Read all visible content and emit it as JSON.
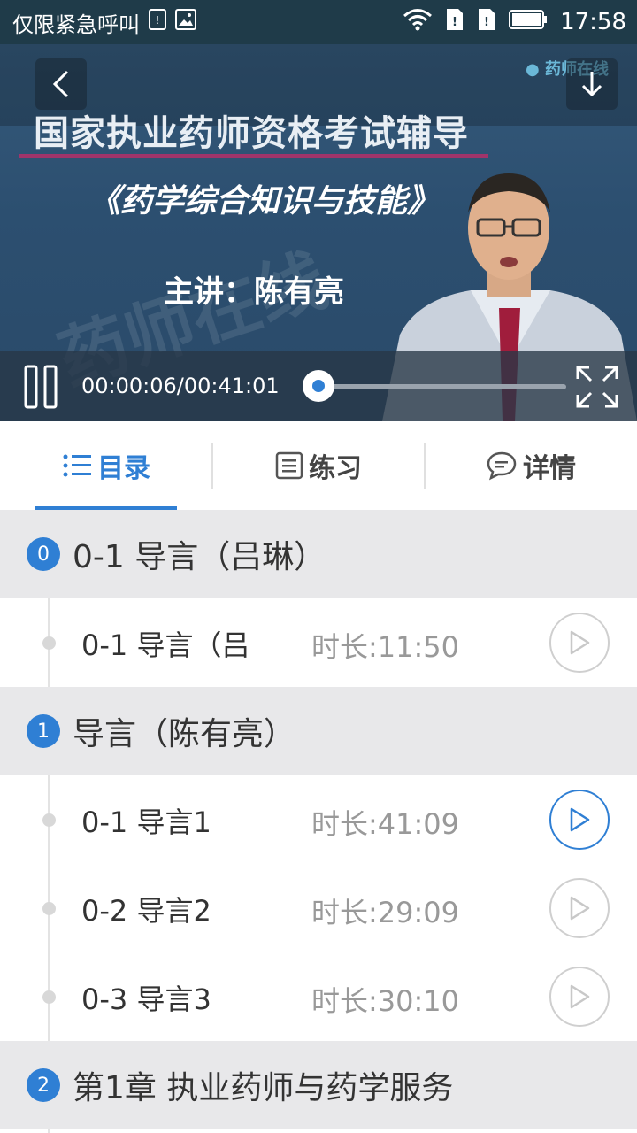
{
  "status_bar": {
    "carrier_text": "仅限紧急呼叫",
    "time": "17:58",
    "icons": [
      "sim-icon",
      "image-icon",
      "wifi-icon",
      "sim1-icon",
      "sim2-icon",
      "battery-icon"
    ]
  },
  "video": {
    "slide_title": "国家执业药师资格考试辅导",
    "slide_subtitle": "《药学综合知识与技能》",
    "slide_speaker": "主讲：陈有亮",
    "watermark": "药师在线",
    "logo_text": "药师在线",
    "time_display": "00:00:06/00:41:01",
    "progress": 0.0024,
    "accent_color": "#2f7fd4"
  },
  "tabs": [
    {
      "label": "目录",
      "icon": "list-icon",
      "active": true
    },
    {
      "label": "练习",
      "icon": "document-icon",
      "active": false
    },
    {
      "label": "详情",
      "icon": "chat-bubble-icon",
      "active": false
    }
  ],
  "chapters": [
    {
      "number": "0",
      "title": "0-1 导言（吕琳）",
      "lessons": [
        {
          "title": "0-1 导言（吕",
          "duration": "时长:11:50",
          "active": false
        }
      ]
    },
    {
      "number": "1",
      "title": "导言（陈有亮）",
      "lessons": [
        {
          "title": "0-1 导言1",
          "duration": "时长:41:09",
          "active": true
        },
        {
          "title": "0-2 导言2",
          "duration": "时长:29:09",
          "active": false
        },
        {
          "title": "0-3 导言3",
          "duration": "时长:30:10",
          "active": false
        }
      ]
    },
    {
      "number": "2",
      "title": "第1章 执业药师与药学服务",
      "lessons": []
    }
  ]
}
